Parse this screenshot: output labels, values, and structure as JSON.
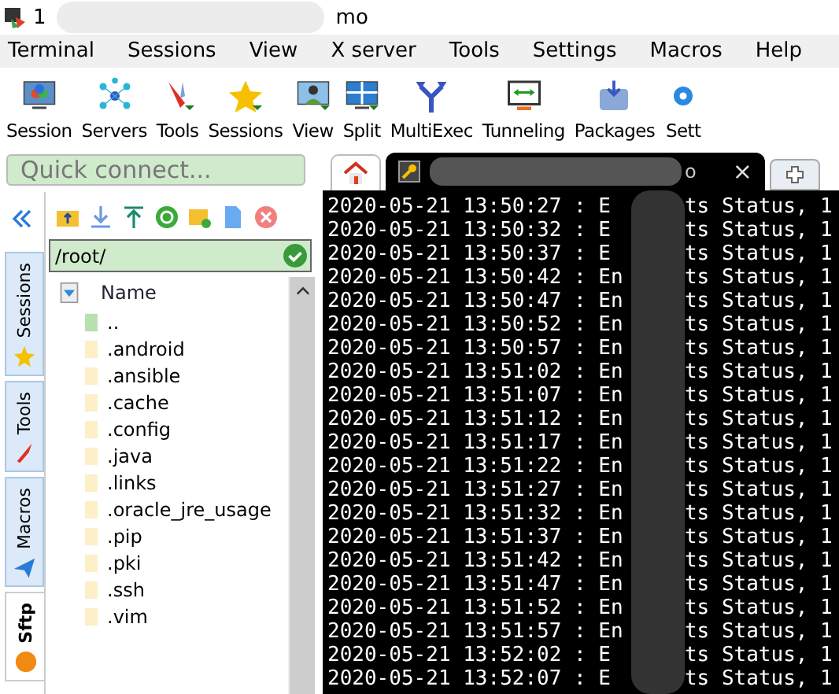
{
  "window": {
    "title_start": "1",
    "title_end": "mo"
  },
  "menu": [
    "Terminal",
    "Sessions",
    "View",
    "X server",
    "Tools",
    "Settings",
    "Macros",
    "Help"
  ],
  "toolbar": [
    "Session",
    "Servers",
    "Tools",
    "Sessions",
    "View",
    "Split",
    "MultiExec",
    "Tunneling",
    "Packages",
    "Sett"
  ],
  "quick_connect": {
    "placeholder": "Quick connect..."
  },
  "side_tabs": [
    {
      "label": "Sessions",
      "selected": false
    },
    {
      "label": "Tools",
      "selected": false
    },
    {
      "label": "Macros",
      "selected": false
    },
    {
      "label": "Sftp",
      "selected": true
    }
  ],
  "sftp": {
    "path": "/root/",
    "column": "Name",
    "files": [
      "..",
      ".android",
      ".ansible",
      ".cache",
      ".config",
      ".java",
      ".links",
      ".oracle_jre_usage",
      ".pip",
      ".pki",
      ".ssh",
      ".vim"
    ]
  },
  "terminal": {
    "tab_label": "o",
    "tab_close": "×",
    "lines": [
      {
        "start": "2020-05-21 13:50:27 : E",
        "end": "ts Status, 1"
      },
      {
        "start": "2020-05-21 13:50:32 : E",
        "end": "ts Status, 1"
      },
      {
        "start": "2020-05-21 13:50:37 : E",
        "end": "ts Status, 1"
      },
      {
        "start": "2020-05-21 13:50:42 : En",
        "end": "ts Status, 1"
      },
      {
        "start": "2020-05-21 13:50:47 : En",
        "end": "ts Status, 1"
      },
      {
        "start": "2020-05-21 13:50:52 : En",
        "end": "ts Status, 1"
      },
      {
        "start": "2020-05-21 13:50:57 : En",
        "end": "ts Status, 1"
      },
      {
        "start": "2020-05-21 13:51:02 : En",
        "end": "ts Status, 1"
      },
      {
        "start": "2020-05-21 13:51:07 : En",
        "end": "ts Status, 1"
      },
      {
        "start": "2020-05-21 13:51:12 : En",
        "end": "ts Status, 1"
      },
      {
        "start": "2020-05-21 13:51:17 : En",
        "end": "ts Status, 1"
      },
      {
        "start": "2020-05-21 13:51:22 : En",
        "end": "ts Status, 1"
      },
      {
        "start": "2020-05-21 13:51:27 : En",
        "end": "ts Status, 1"
      },
      {
        "start": "2020-05-21 13:51:32 : En",
        "end": "ts Status, 1"
      },
      {
        "start": "2020-05-21 13:51:37 : En",
        "end": "ts Status, 1"
      },
      {
        "start": "2020-05-21 13:51:42 : En",
        "end": "ts Status, 1"
      },
      {
        "start": "2020-05-21 13:51:47 : En",
        "end": "ts Status, 1"
      },
      {
        "start": "2020-05-21 13:51:52 : En",
        "end": "ts Status, 1"
      },
      {
        "start": "2020-05-21 13:51:57 : En",
        "end": "ts Status, 1"
      },
      {
        "start": "2020-05-21 13:52:02 : E",
        "end": "ts Status, 1"
      },
      {
        "start": "2020-05-21 13:52:07 : E",
        "end": "ts Status, 1"
      }
    ]
  }
}
